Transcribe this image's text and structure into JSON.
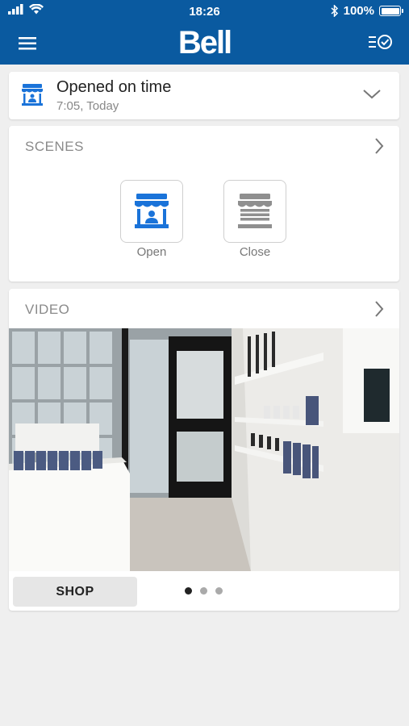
{
  "status_bar": {
    "time": "18:26",
    "battery": "100%",
    "icons": [
      "signal-icon",
      "wifi-icon",
      "bluetooth-icon",
      "battery-icon"
    ]
  },
  "app_bar": {
    "logo": "Bell",
    "left_icon": "menu-icon",
    "right_icon": "checklist-icon"
  },
  "store_status": {
    "title": "Opened on time",
    "subtitle": "7:05, Today",
    "icon": "storefront-icon"
  },
  "scenes": {
    "heading": "SCENES",
    "items": [
      {
        "label": "Open",
        "icon": "storefront-open-icon"
      },
      {
        "label": "Close",
        "icon": "storefront-closed-icon"
      }
    ]
  },
  "video": {
    "heading": "VIDEO",
    "camera_label": "SHOP",
    "pages": 3,
    "active_page": 1
  },
  "colors": {
    "brand_blue": "#0a5aa0",
    "icon_blue": "#1a73d9",
    "icon_grey": "#8f8f8f",
    "background": "#efefef"
  }
}
